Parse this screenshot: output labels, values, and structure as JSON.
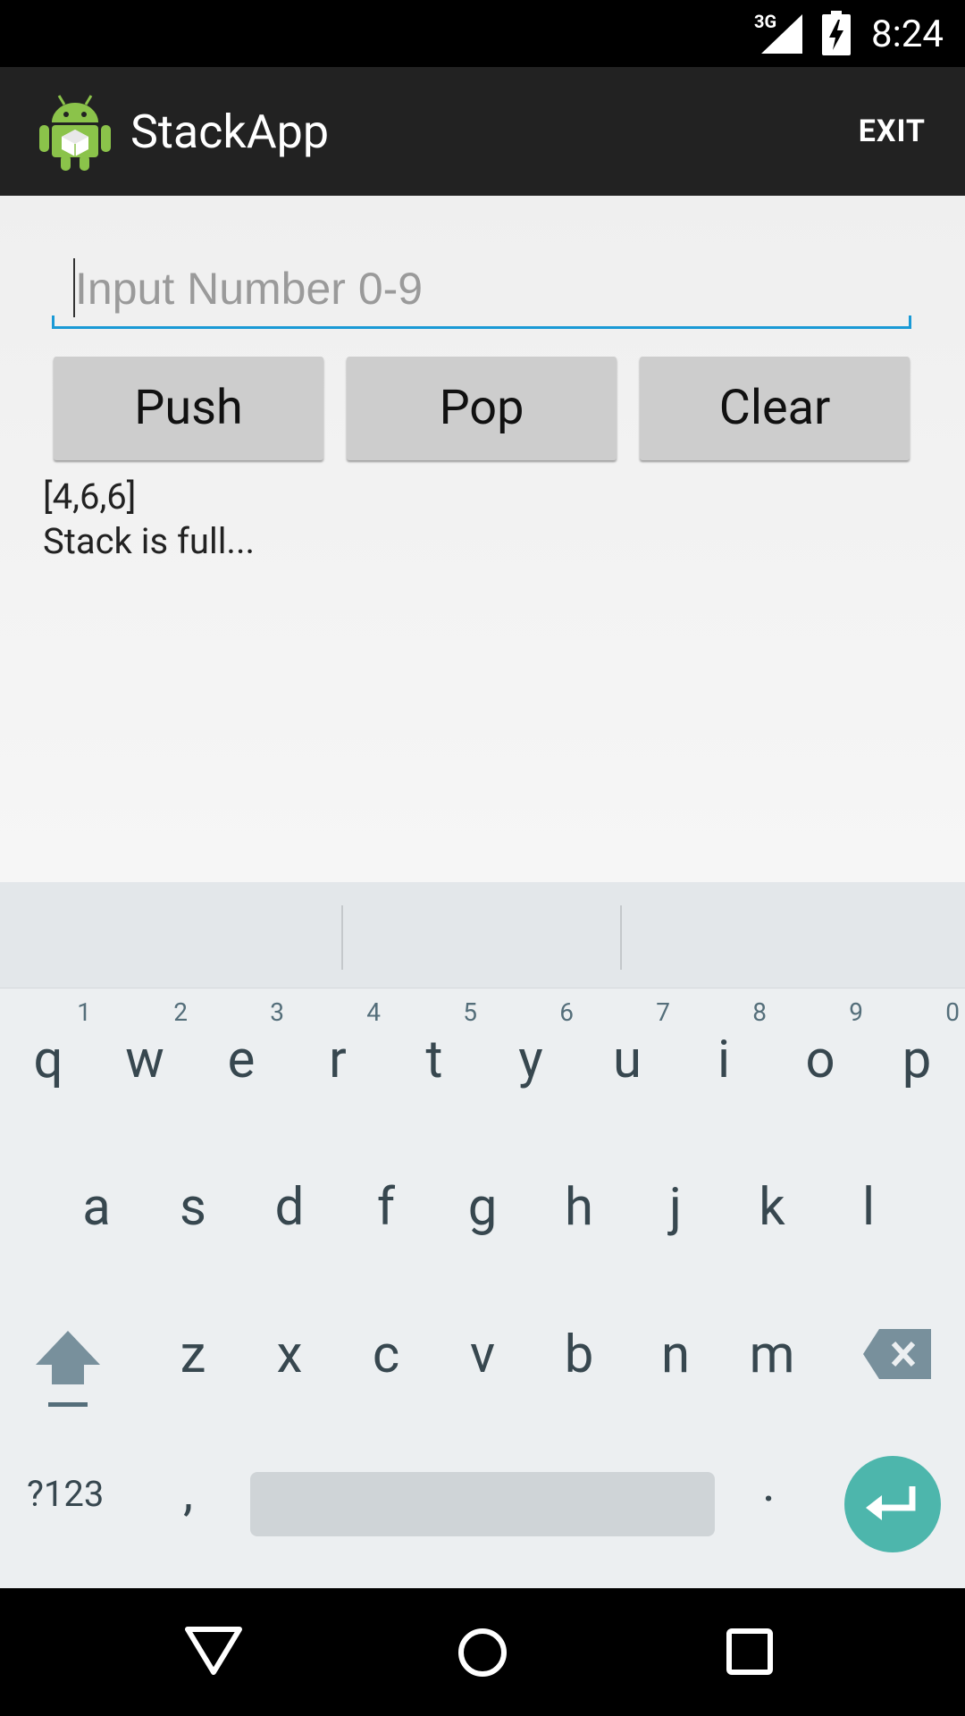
{
  "status": {
    "network": "3G",
    "time": "8:24"
  },
  "app": {
    "title": "StackApp",
    "exit_label": "EXIT"
  },
  "input": {
    "placeholder": "Input Number 0-9",
    "value": ""
  },
  "buttons": {
    "push": "Push",
    "pop": "Pop",
    "clear": "Clear"
  },
  "output": {
    "stack": "[4,6,6]",
    "message": "Stack is full..."
  },
  "keyboard": {
    "row1": [
      {
        "key": "q",
        "hint": "1"
      },
      {
        "key": "w",
        "hint": "2"
      },
      {
        "key": "e",
        "hint": "3"
      },
      {
        "key": "r",
        "hint": "4"
      },
      {
        "key": "t",
        "hint": "5"
      },
      {
        "key": "y",
        "hint": "6"
      },
      {
        "key": "u",
        "hint": "7"
      },
      {
        "key": "i",
        "hint": "8"
      },
      {
        "key": "o",
        "hint": "9"
      },
      {
        "key": "p",
        "hint": "0"
      }
    ],
    "row2": [
      "a",
      "s",
      "d",
      "f",
      "g",
      "h",
      "j",
      "k",
      "l"
    ],
    "row3": [
      "z",
      "x",
      "c",
      "v",
      "b",
      "n",
      "m"
    ],
    "symbols_label": "?123",
    "comma": ",",
    "period": "."
  },
  "colors": {
    "accent": "#1a9ad6",
    "enter": "#4db6ac",
    "actionbar": "#222222"
  },
  "icons": [
    "android-app-icon",
    "signal-icon",
    "battery-charging-icon",
    "shift-icon",
    "backspace-icon",
    "enter-icon",
    "back-icon",
    "home-icon",
    "recents-icon"
  ]
}
